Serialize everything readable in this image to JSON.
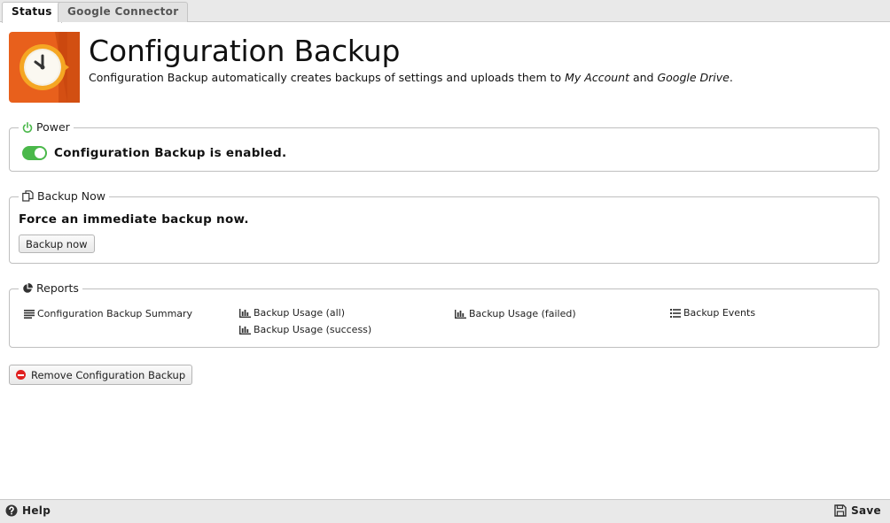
{
  "tabs": [
    {
      "label": "Status",
      "active": true
    },
    {
      "label": "Google Connector",
      "active": false
    }
  ],
  "header": {
    "title": "Configuration Backup",
    "desc_prefix": "Configuration Backup automatically creates backups of settings and uploads them to ",
    "desc_em1": "My Account",
    "desc_and": " and ",
    "desc_em2": "Google Drive",
    "desc_suffix": "."
  },
  "power": {
    "legend": "Power",
    "enabled": true,
    "status_text": "Configuration Backup is enabled."
  },
  "backup_now": {
    "legend": "Backup Now",
    "text": "Force an immediate backup now.",
    "button_label": "Backup now"
  },
  "reports": {
    "legend": "Reports",
    "links": [
      {
        "label": "Configuration Backup Summary",
        "icon": "lines-icon"
      },
      {
        "label": "Backup Usage (all)",
        "icon": "bar-chart-icon"
      },
      {
        "label": "Backup Usage (success)",
        "icon": "bar-chart-icon"
      },
      {
        "label": "Backup Usage (failed)",
        "icon": "bar-chart-icon"
      },
      {
        "label": "Backup Events",
        "icon": "list-icon"
      }
    ]
  },
  "remove_button_label": "Remove Configuration Backup",
  "footer": {
    "help_label": "Help",
    "save_label": "Save"
  },
  "colors": {
    "toggle_on": "#4ab84a",
    "icon_orange": "#e8601c",
    "remove_red": "#e02020",
    "power_green": "#4ab84a"
  }
}
